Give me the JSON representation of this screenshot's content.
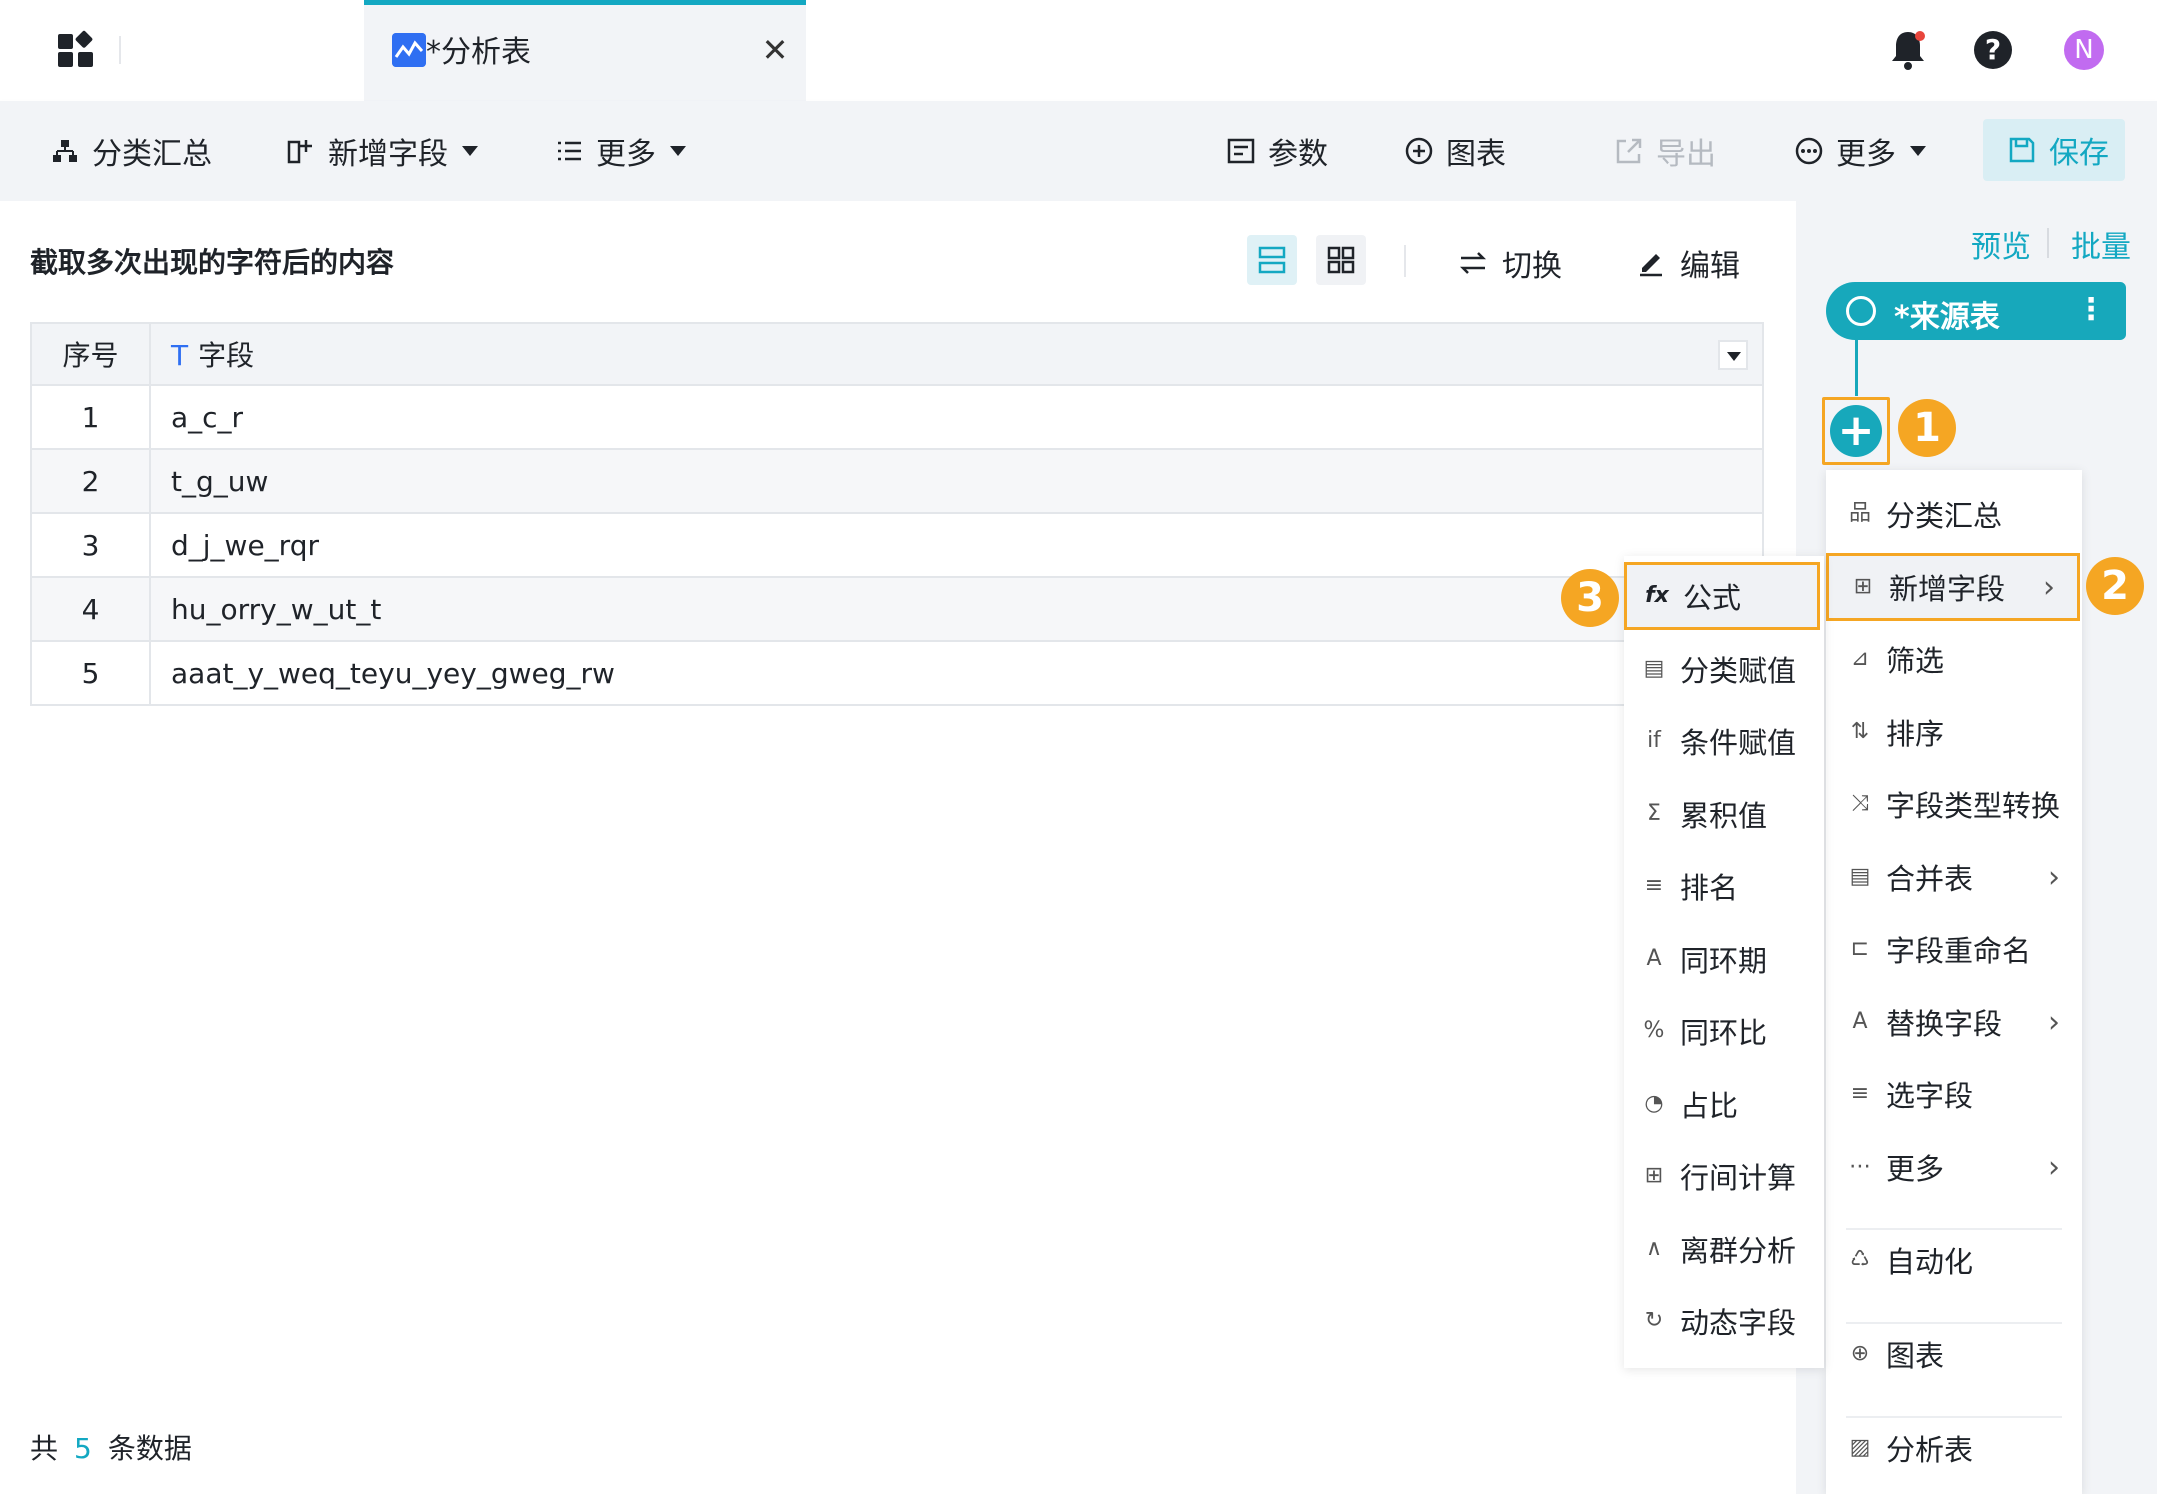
{
  "tab": {
    "title": "*分析表",
    "close": "✕"
  },
  "header": {
    "help": "?",
    "avatar": "N"
  },
  "toolbar": {
    "group": "分类汇总",
    "add_field": "新增字段",
    "more_left": "更多",
    "params": "参数",
    "chart": "图表",
    "export": "导出",
    "more_right": "更多",
    "save": "保存"
  },
  "main": {
    "title": "截取多次出现的字符后的内容",
    "switch": "切换",
    "edit": "编辑",
    "table": {
      "headers": [
        "序号",
        "字段"
      ],
      "rows": [
        [
          "1",
          "a_c_r"
        ],
        [
          "2",
          "t_g_uw"
        ],
        [
          "3",
          "d_j_we_rqr"
        ],
        [
          "4",
          "hu_orry_w_ut_t"
        ],
        [
          "5",
          "aaat_y_weq_teyu_yey_gweg_rw"
        ]
      ]
    },
    "footer": {
      "prefix": "共",
      "count": "5",
      "suffix": "条数据"
    }
  },
  "right_panel": {
    "preview": "预览",
    "batch": "批量",
    "source_node": "*来源表",
    "badges": [
      "1",
      "2",
      "3"
    ]
  },
  "menu_main": [
    {
      "label": "分类汇总",
      "icon": "group-icon"
    },
    {
      "label": "新增字段",
      "icon": "add-field-icon",
      "has_sub": true
    },
    {
      "label": "筛选",
      "icon": "filter-icon"
    },
    {
      "label": "排序",
      "icon": "sort-icon"
    },
    {
      "label": "字段类型转换",
      "icon": "type-convert-icon"
    },
    {
      "label": "合并表",
      "icon": "merge-icon",
      "has_sub": true
    },
    {
      "label": "字段重命名",
      "icon": "rename-icon"
    },
    {
      "label": "替换字段",
      "icon": "replace-icon",
      "has_sub": true
    },
    {
      "label": "选字段",
      "icon": "select-field-icon"
    },
    {
      "label": "更多",
      "icon": "more-icon",
      "has_sub": true
    },
    {
      "label": "自动化",
      "icon": "automation-icon"
    },
    {
      "label": "图表",
      "icon": "chart-icon"
    },
    {
      "label": "分析表",
      "icon": "analysis-table-icon"
    }
  ],
  "menu_sub": [
    {
      "label": "公式",
      "icon": "formula-icon"
    },
    {
      "label": "分类赋值",
      "icon": "category-assign-icon"
    },
    {
      "label": "条件赋值",
      "icon": "condition-assign-icon"
    },
    {
      "label": "累积值",
      "icon": "cumulative-icon"
    },
    {
      "label": "排名",
      "icon": "rank-icon"
    },
    {
      "label": "同环期",
      "icon": "period-icon"
    },
    {
      "label": "同环比",
      "icon": "ratio-icon"
    },
    {
      "label": "占比",
      "icon": "proportion-icon"
    },
    {
      "label": "行间计算",
      "icon": "row-calc-icon"
    },
    {
      "label": "离群分析",
      "icon": "outlier-icon"
    },
    {
      "label": "动态字段",
      "icon": "dynamic-field-icon"
    }
  ],
  "colors": {
    "accent": "#13a8c2",
    "highlight": "#f5a623"
  }
}
